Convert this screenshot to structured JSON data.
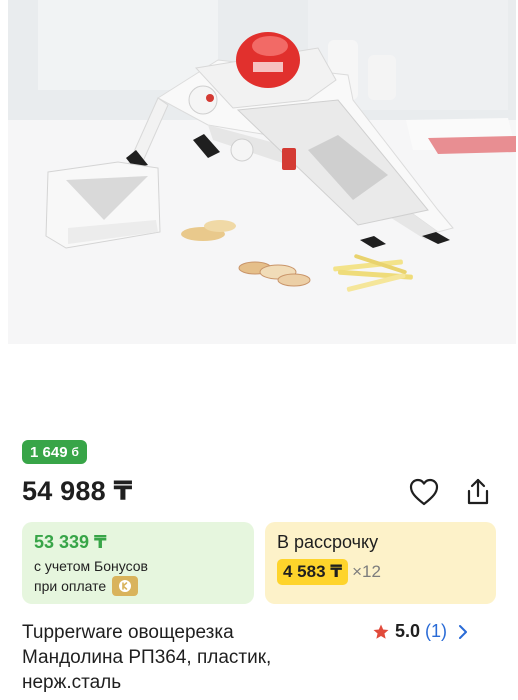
{
  "product": {
    "bonus_amount": "1 649",
    "bonus_icon": "б",
    "price": "54 988 ₸",
    "name_lines": [
      "Tupperware овощерезка",
      "Мандолина РП364, пластик,",
      "нерж.сталь"
    ],
    "rating": {
      "score": "5.0",
      "count": "(1)"
    }
  },
  "bonus_offer": {
    "amount": "53 339 ₸",
    "line1": "с учетом Бонусов",
    "line2": "при оплате"
  },
  "installment": {
    "title": "В рассрочку",
    "monthly": "4 583 ₸",
    "times": "×12"
  },
  "icons": {
    "favorite": "heart-icon",
    "share": "share-icon",
    "star": "star-icon",
    "chevron": "chevron-right-icon",
    "bonus_badge": "kaspi-badge-icon"
  },
  "colors": {
    "bonus_green": "#38a548",
    "bonus_bg": "#e6f6de",
    "installment_bg": "#fdf2c9",
    "installment_pill": "#fed42b",
    "star": "#e14a3b",
    "link_blue": "#2a6bd6"
  }
}
